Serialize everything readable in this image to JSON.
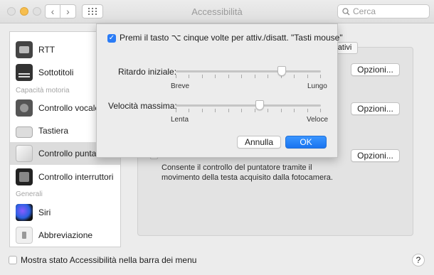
{
  "window": {
    "title": "Accessibilità",
    "search_placeholder": "Cerca"
  },
  "sidebar": {
    "items": [
      {
        "label": "RTT",
        "icon": "rtt-icon"
      },
      {
        "label": "Sottotitoli",
        "icon": "subtitles-icon"
      },
      {
        "label": "Controllo vocale",
        "icon": "voice-control-icon"
      },
      {
        "label": "Tastiera",
        "icon": "keyboard-icon"
      },
      {
        "label": "Controllo puntatore",
        "icon": "pointer-control-icon",
        "selected": true
      },
      {
        "label": "Controllo interruttori",
        "icon": "switch-control-icon"
      },
      {
        "label": "Siri",
        "icon": "siri-icon"
      },
      {
        "label": "Abbreviazione",
        "icon": "shortcut-icon"
      }
    ],
    "headers": {
      "motor": "Capacità motoria",
      "general": "Generali"
    }
  },
  "main": {
    "tab_alt_label": "rnativi",
    "options_label": "Opzioni...",
    "description": "Consente il controllo del puntatore tramite il movimento della testa acquisito dalla fotocamera."
  },
  "footer": {
    "show_status_label": "Mostra stato Accessibilità nella barra dei menu",
    "help_label": "?"
  },
  "sheet": {
    "checkbox_label": "Premi il tasto ⌥ cinque volte per attiv./disatt. \"Tasti mouse\"",
    "checkbox_checked": true,
    "initial_delay": {
      "label": "Ritardo iniziale:",
      "min_label": "Breve",
      "max_label": "Lungo",
      "value": 0.73
    },
    "max_speed": {
      "label": "Velocità massima:",
      "min_label": "Lenta",
      "max_label": "Veloce",
      "value": 0.58
    },
    "cancel_label": "Annulla",
    "ok_label": "OK"
  },
  "colors": {
    "accent": "#2b7cf6",
    "ok_button": "#1a74f0",
    "background": "#ececec"
  }
}
